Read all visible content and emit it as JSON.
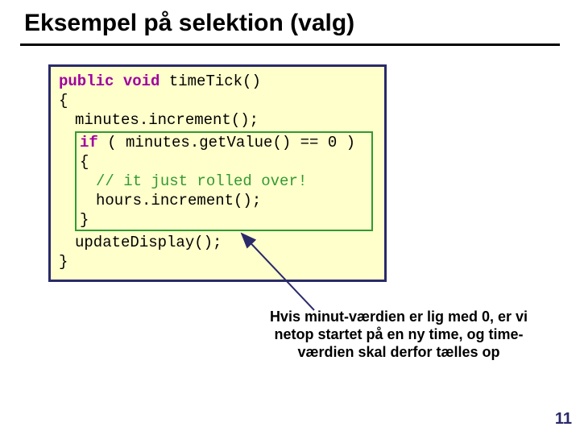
{
  "title": "Eksempel på selektion (valg)",
  "code": {
    "kw_public": "public",
    "kw_void": "void",
    "method_sig": " timeTick()",
    "lbrace": "{",
    "stmt_minutes_inc": "minutes.increment();",
    "kw_if": "if",
    "if_cond": " ( minutes.getValue() == 0 ) {",
    "comment": "// it just rolled over!",
    "stmt_hours_inc": "hours.increment();",
    "if_close": "}",
    "stmt_update": "updateDisplay();",
    "rbrace": "}"
  },
  "caption": "Hvis minut-værdien er lig med 0, er vi netop startet på en ny time, og time-værdien skal derfor tælles op",
  "page_number": "11"
}
